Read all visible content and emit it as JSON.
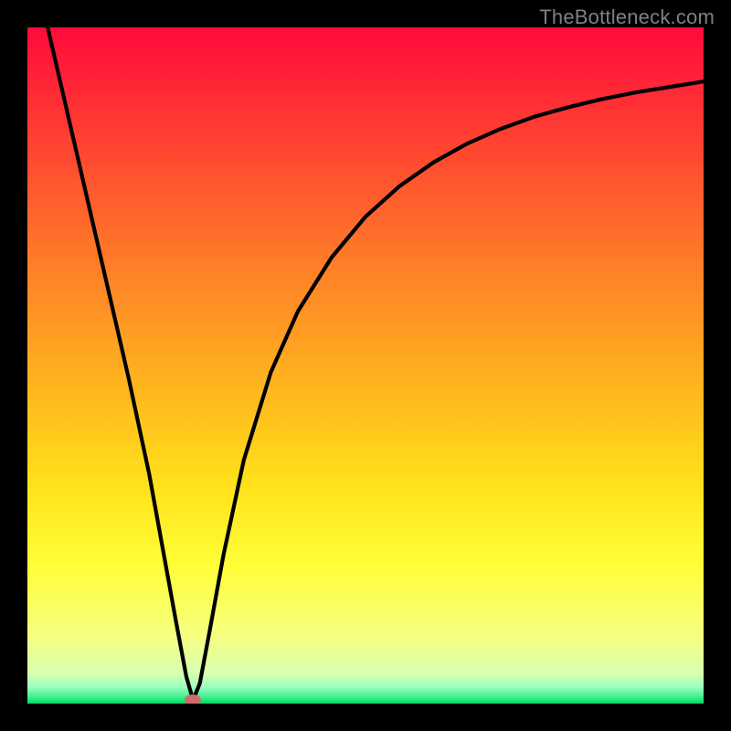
{
  "watermark": "TheBottleneck.com",
  "colors": {
    "frame": "#000000",
    "gradient_top": "#ff0a3a",
    "gradient_mid1": "#ff6a2a",
    "gradient_mid2": "#ffc51f",
    "gradient_mid3": "#ffff40",
    "gradient_mid4": "#f6ff8a",
    "gradient_bottom": "#00e060",
    "curve": "#000000",
    "marker": "#cc6d6d"
  },
  "chart_data": {
    "type": "line",
    "title": "",
    "xlabel": "",
    "ylabel": "",
    "xlim": [
      0,
      100
    ],
    "ylim": [
      0,
      100
    ],
    "series": [
      {
        "name": "curve",
        "x": [
          3,
          6,
          9,
          12,
          15,
          18,
          20,
          22,
          23.5,
          24.5,
          25.5,
          27,
          29,
          32,
          36,
          40,
          45,
          50,
          55,
          60,
          65,
          70,
          75,
          80,
          85,
          90,
          95,
          100
        ],
        "y": [
          100,
          87,
          74,
          61,
          48,
          34,
          23,
          12,
          4,
          0.5,
          3,
          11,
          22,
          36,
          49,
          58,
          66,
          72,
          76.5,
          80,
          82.8,
          85,
          86.8,
          88.2,
          89.4,
          90.4,
          91.2,
          92
        ]
      }
    ],
    "marker": {
      "x": 24.5,
      "y": 0.5
    },
    "annotations": []
  }
}
